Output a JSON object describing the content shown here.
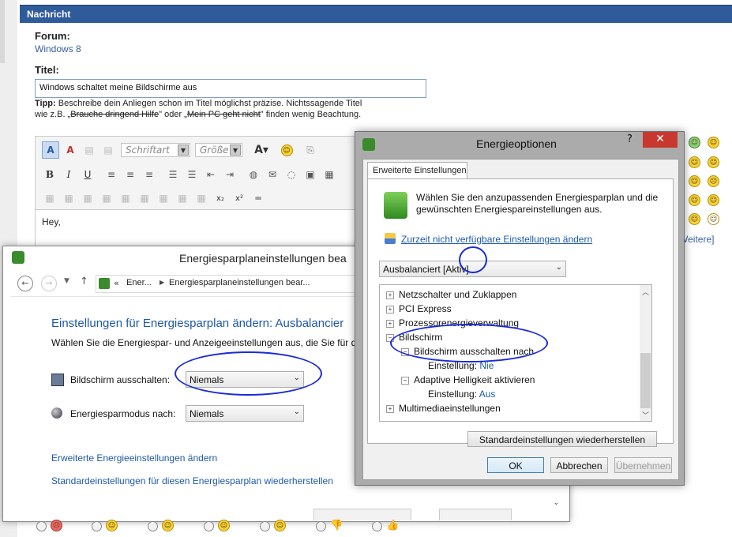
{
  "forum_header": {
    "title": "Nachricht"
  },
  "forum": {
    "forum_label": "Forum:",
    "forum_value": "Windows 8",
    "title_label": "Titel:",
    "title_value": "Windows schaltet meine Bildschirme aus",
    "tip_bold": "Tipp:",
    "tip_text": " Beschreibe dein Anliegen schon im Titel möglichst präzise. Nichtssagende Titel",
    "tip_line2_a": "wie z.B. „",
    "tip_strike1": "Brauche dringend Hilfe",
    "tip_line2_b": "\" oder „",
    "tip_strike2": "Mein PC geht nicht",
    "tip_line2_c": "\" finden wenig Beachtung.",
    "more_link": "Weitere]"
  },
  "editor": {
    "font_placeholder": "Schriftart",
    "size_placeholder": "Größe",
    "body_text": "Hey,"
  },
  "win1": {
    "title": "Energiesparplaneinstellungen bea",
    "breadcrumb_1": "Ener...",
    "breadcrumb_2": "Energiesparplaneinstellungen bear...",
    "heading": "Einstellungen für Energiesparplan ändern: Ausbalancier",
    "subtext": "Wählen Sie die Energiespar- und Anzeigeeinstellungen aus, die Sie für der",
    "screen_off_label": "Bildschirm ausschalten:",
    "screen_off_value": "Niemals",
    "sleep_label": "Energiesparmodus nach:",
    "sleep_value": "Niemals",
    "link_advanced": "Erweiterte Energieeinstellungen ändern",
    "link_restore": "Standardeinstellungen für diesen Energiesparplan wiederherstellen"
  },
  "win2": {
    "title": "Energieoptionen",
    "help": "?",
    "close": "✕",
    "tab": "Erweiterte Einstellungen",
    "intro": "Wählen Sie den anzupassenden Energiesparplan und die gewünschten Energiespareinstellungen aus.",
    "change_link": "Zurzeit nicht verfügbare Einstellungen ändern",
    "plan_value": "Ausbalanciert [Aktiv]",
    "tree": {
      "item1": "Netzschalter und Zuklappen",
      "item2": "PCI Express",
      "item3": "Prozessorenergieverwaltung",
      "item4": "Bildschirm",
      "item4a": "Bildschirm ausschalten nach",
      "item4a_setting": "Einstellung:",
      "item4a_value": "Nie",
      "item4b": "Adaptive Helligkeit aktivieren",
      "item4b_setting": "Einstellung:",
      "item4b_value": "Aus",
      "item5": "Multimediaeinstellungen"
    },
    "restore_button": "Standardeinstellungen wiederherstellen",
    "ok": "OK",
    "cancel": "Abbrechen",
    "apply": "Übernehmen"
  },
  "colors": {
    "header_blue": "#2f5b9b",
    "link_blue": "#1e5aa8",
    "annotation": "#1a2bd6",
    "close_red": "#c7392f"
  }
}
